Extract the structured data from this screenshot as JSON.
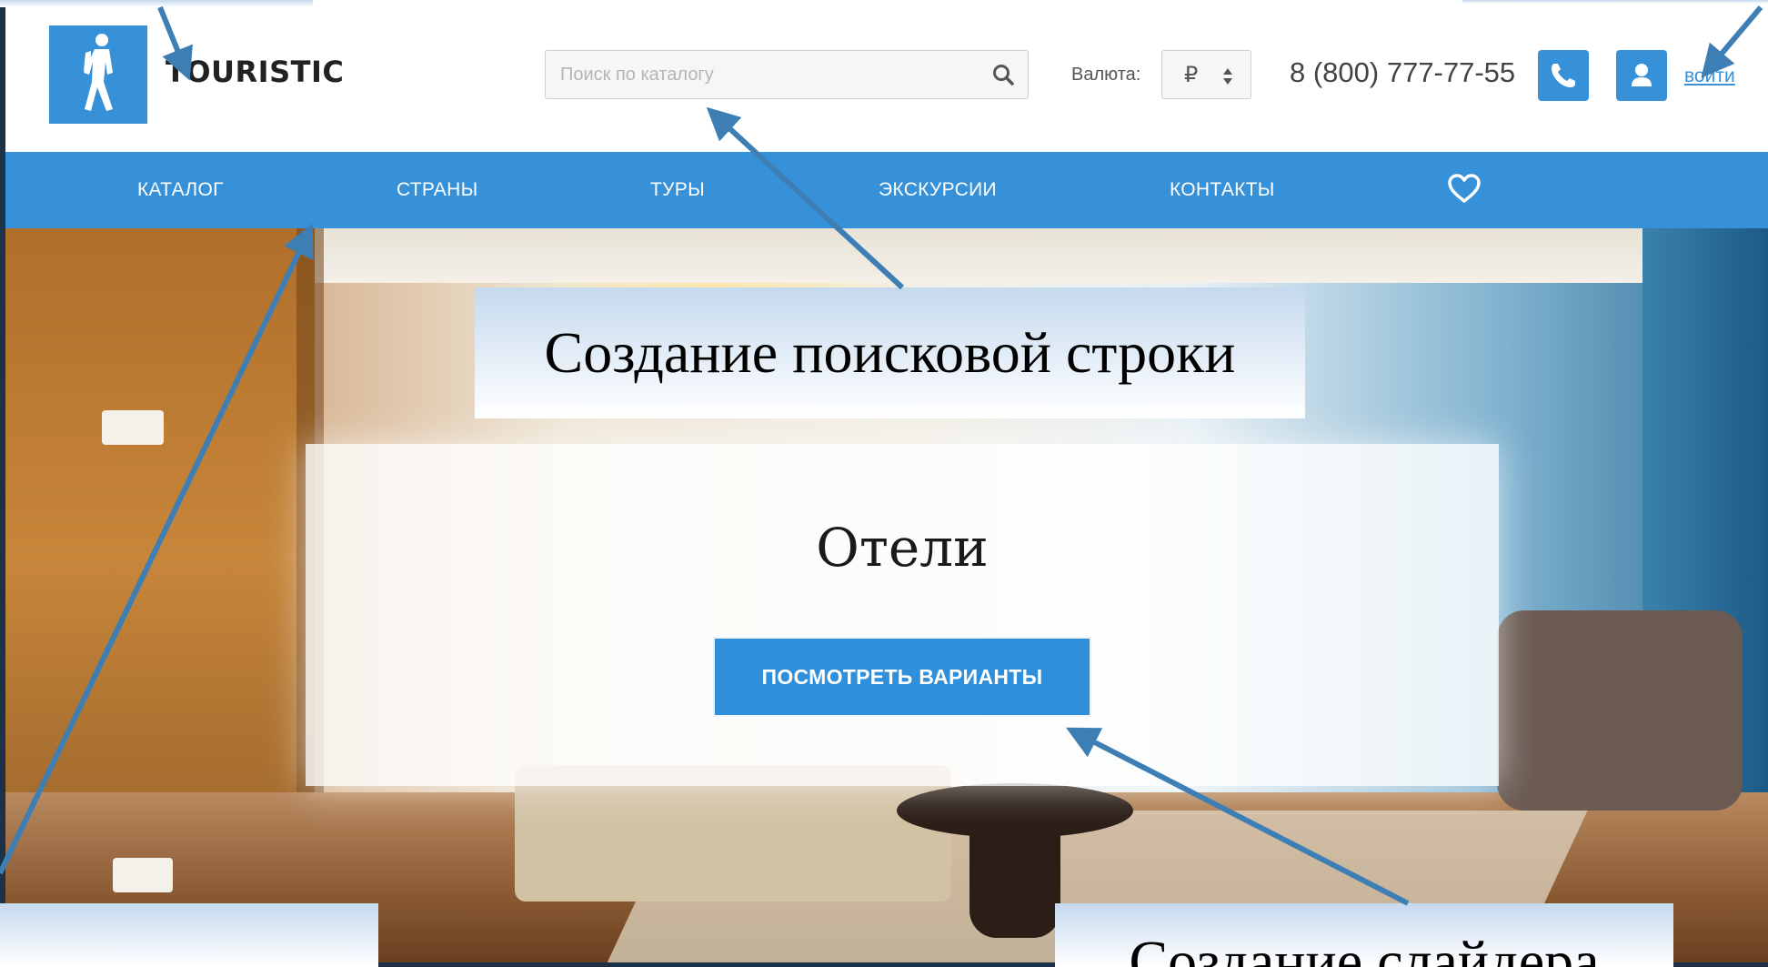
{
  "header": {
    "logo_text": "TOURISTIC",
    "search_placeholder": "Поиск по каталогу",
    "currency_label": "Валюта:",
    "currency_value": "₽",
    "phone": "8 (800) 777-77-55",
    "login_label": "войти"
  },
  "nav": {
    "items": [
      {
        "label": "КАТАЛОГ"
      },
      {
        "label": "СТРАНЫ"
      },
      {
        "label": "ТУРЫ"
      },
      {
        "label": "ЭКСКУРСИИ"
      },
      {
        "label": "КОНТАКТЫ"
      }
    ]
  },
  "hero": {
    "title": "Отели",
    "button_label": "ПОСМОТРЕТЬ ВАРИАНТЫ"
  },
  "annotations": {
    "search_caption": "Создание поисковой строки",
    "slider_caption": "Создание слайдера"
  },
  "colors": {
    "accent": "#3691d8",
    "annotation_arrow": "#3d7fb5"
  }
}
